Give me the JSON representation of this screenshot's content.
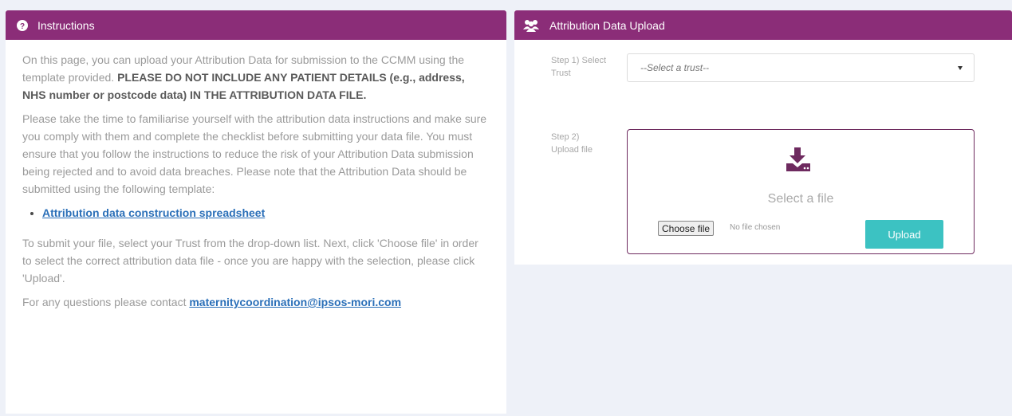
{
  "instructions": {
    "title": "Instructions",
    "para1_normal": "On this page, you can upload your Attribution Data for submission to the CCMM using the template provided. ",
    "para1_bold": "PLEASE DO NOT INCLUDE ANY PATIENT DETAILS (e.g., address, NHS number or postcode data) IN THE ATTRIBUTION DATA FILE.",
    "para2": "Please take the time to familiarise yourself with the attribution data instructions and make sure you comply with them and complete the checklist before submitting your data file. You must ensure that you follow the instructions to reduce the risk of your Attribution Data submission being rejected and to avoid data breaches. Please note that the Attribution Data should be submitted using the following template:",
    "template_link": "Attribution data construction spreadsheet",
    "para3": "To submit your file, select your Trust from the drop-down list. Next, click 'Choose file' in order to select the correct attribution data file - once you are happy with the selection, please click 'Upload'.",
    "contact_prefix": "For any questions please contact ",
    "contact_email": "maternitycoordination@ipsos-mori.com"
  },
  "upload": {
    "title": "Attribution Data Upload",
    "step1_label": "Step 1) Select Trust",
    "trust_select_value": "--Select a trust--",
    "step2_label": "Step 2) Upload file",
    "select_file_text": "Select a file",
    "choose_file_label": "Choose file",
    "no_file_text": "No file chosen",
    "upload_button": "Upload"
  },
  "colors": {
    "header": "#8b2d78",
    "upload_button": "#3cc2c2",
    "link": "#2a6fb8"
  },
  "icons": {
    "instructions": "question-circle-icon",
    "upload_header": "users-icon",
    "upload_area": "download-icon"
  }
}
